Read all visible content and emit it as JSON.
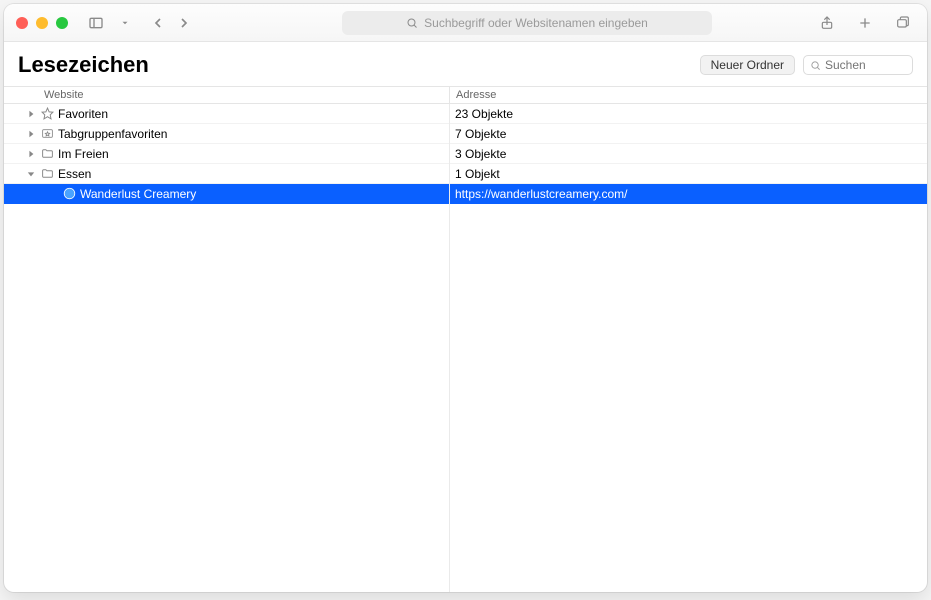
{
  "address_bar": {
    "placeholder": "Suchbegriff oder Websitenamen eingeben"
  },
  "page": {
    "title": "Lesezeichen"
  },
  "header_actions": {
    "new_folder_label": "Neuer Ordner",
    "search_placeholder": "Suchen"
  },
  "columns": {
    "website": "Website",
    "address": "Adresse"
  },
  "tree": {
    "rows": [
      {
        "icon": "star",
        "disclosure": "closed",
        "label": "Favoriten",
        "address": "23 Objekte",
        "indent": 0,
        "selected": false
      },
      {
        "icon": "tabgroup",
        "disclosure": "closed",
        "label": "Tabgruppenfavoriten",
        "address": "7 Objekte",
        "indent": 0,
        "selected": false
      },
      {
        "icon": "folder",
        "disclosure": "closed",
        "label": "Im Freien",
        "address": "3 Objekte",
        "indent": 0,
        "selected": false
      },
      {
        "icon": "folder",
        "disclosure": "open",
        "label": "Essen",
        "address": "1 Objekt",
        "indent": 0,
        "selected": false
      },
      {
        "icon": "favicon",
        "disclosure": "none",
        "label": "Wanderlust Creamery",
        "address": "https://wanderlustcreamery.com/",
        "indent": 1,
        "selected": true
      }
    ]
  }
}
